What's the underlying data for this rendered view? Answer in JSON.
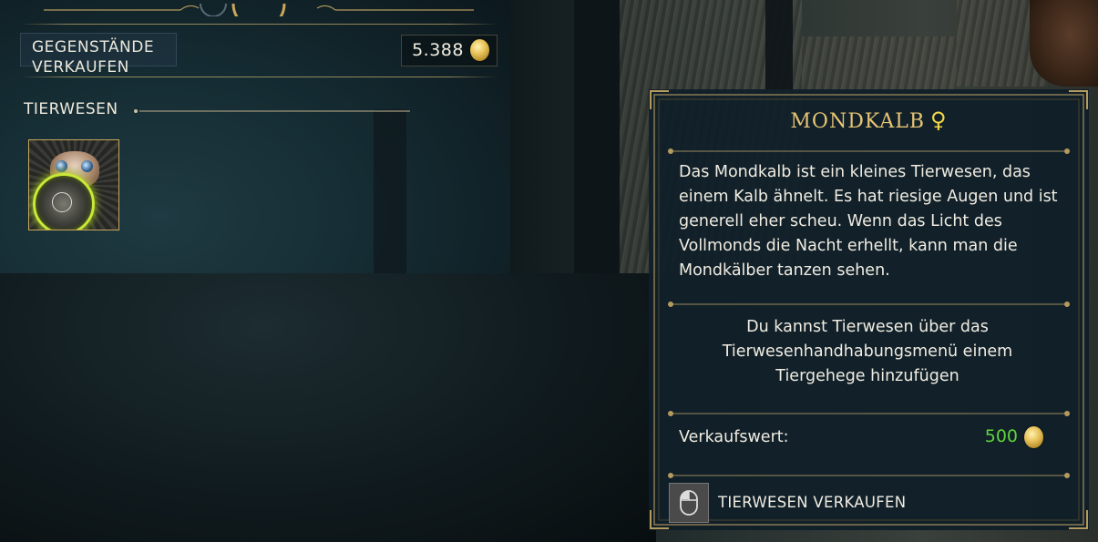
{
  "header": {
    "sell_items_label": "GEGENSTÄNDE\nVERKAUFEN",
    "money": "5.388"
  },
  "section": {
    "title": "TIERWESEN"
  },
  "details": {
    "name": "MONDKALB",
    "gender_symbol": "♀",
    "description": "Das Mondkalb ist ein kleines Tierwesen, das einem Kalb ähnelt. Es hat riesige Augen und ist generell eher scheu. Wenn das Licht des Vollmonds die Nacht erhellt, kann man die Mondkälber tanzen sehen.",
    "hint": "Du kannst Tierwesen über das Tierwesenhandhabungsmenü einem Tiergehege hinzufügen",
    "value_label": "Verkaufswert:",
    "value": "500",
    "action_label": "TIERWESEN VERKAUFEN"
  },
  "colors": {
    "accent_gold": "#e6c474",
    "value_green": "#5fd43a",
    "frame_gold": "#b59a5e",
    "selection_ring": "#c9e838"
  }
}
